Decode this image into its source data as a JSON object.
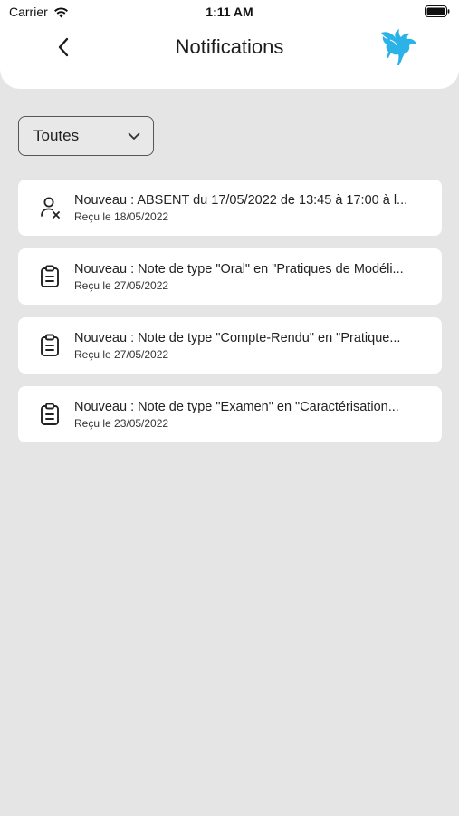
{
  "status_bar": {
    "carrier": "Carrier",
    "time": "1:11 AM"
  },
  "header": {
    "title": "Notifications",
    "back_icon": "chevron-left-icon",
    "logo_icon": "pegasus-logo-icon"
  },
  "filter": {
    "selected": "Toutes",
    "icon": "chevron-down-icon"
  },
  "notifications": [
    {
      "icon": "user-absent-icon",
      "title": "Nouveau : ABSENT du 17/05/2022 de 13:45 à 17:00 à l...",
      "date": "Reçu le 18/05/2022"
    },
    {
      "icon": "clipboard-icon",
      "title": "Nouveau : Note de type \"Oral\" en \"Pratiques de Modéli...",
      "date": "Reçu le 27/05/2022"
    },
    {
      "icon": "clipboard-icon",
      "title": "Nouveau : Note de type \"Compte-Rendu\" en \"Pratique...",
      "date": "Reçu le 27/05/2022"
    },
    {
      "icon": "clipboard-icon",
      "title": "Nouveau : Note de type \"Examen\" en \"Caractérisation...",
      "date": "Reçu le 23/05/2022"
    }
  ],
  "colors": {
    "background": "#e5e5e5",
    "card": "#ffffff",
    "logo": "#2bb3e8"
  }
}
